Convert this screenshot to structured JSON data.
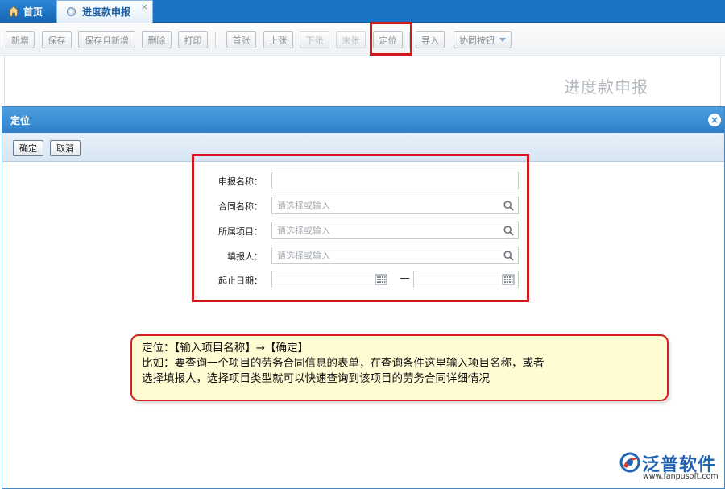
{
  "tabs": {
    "home_label": "首页",
    "active_label": "进度款申报",
    "close_glyph": "×"
  },
  "toolbar": {
    "buttons": [
      "新增",
      "保存",
      "保存且新增",
      "删除",
      "打印",
      "首张",
      "上张",
      "下张",
      "末张",
      "定位",
      "导入",
      "协同按钮"
    ]
  },
  "page": {
    "heading": "进度款申报"
  },
  "dialog": {
    "title": "定位",
    "close_glyph": "×",
    "confirm_label": "确定",
    "cancel_label": "取消",
    "form": {
      "report_name_label": "申报名称：",
      "report_name_value": "",
      "contract_name_label": "合同名称：",
      "contract_name_placeholder": "请选择或输入",
      "project_label": "所属项目：",
      "project_placeholder": "请选择或输入",
      "reporter_label": "填报人：",
      "reporter_placeholder": "请选择或输入",
      "date_range_label": "起止日期：",
      "date_separator": "—"
    }
  },
  "note": {
    "line1": "定位：【输入项目名称】→【确定】",
    "line2": "比如：要查询一个项目的劳务合同信息的表单，在查询条件这里输入项目名称，或者",
    "line3": "选择填报人，选择项目类型就可以快速查询到该项目的劳务合同详细情况"
  },
  "logo": {
    "name": "泛普软件",
    "url": "www.fanpusoft.com"
  },
  "colors": {
    "tab_bar": "#1b73c6",
    "dialog_title": "#2f80c9",
    "highlight": "#d3181d",
    "note_bg": "#fffbd3",
    "logo_blue": "#1f63b4"
  },
  "icons": [
    "home-icon",
    "tab-dot-icon",
    "close-icon",
    "search-icon",
    "calendar-icon",
    "chevron-down-icon",
    "fanpu-logo-icon"
  ]
}
